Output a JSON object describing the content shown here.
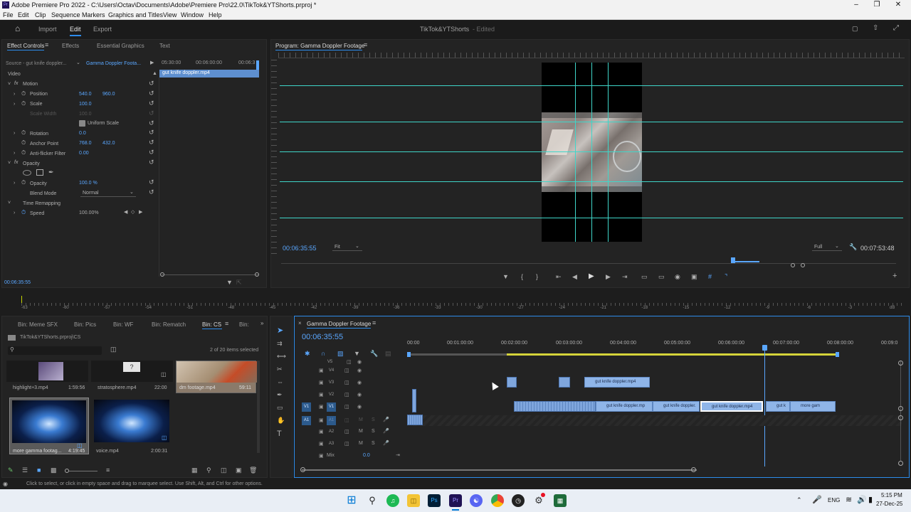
{
  "window": {
    "title": "Adobe Premiere Pro 2022 - C:\\Users\\Octav\\Documents\\Adobe\\Premiere Pro\\22.0\\TikTok&YTShorts.prproj *",
    "logo": "Pr"
  },
  "menu": [
    "File",
    "Edit",
    "Clip",
    "Sequence",
    "Markers",
    "Graphics and Titles",
    "View",
    "Window",
    "Help"
  ],
  "workspace": {
    "tabs": [
      "Import",
      "Edit",
      "Export"
    ],
    "active": "Edit",
    "project_name": "TikTok&YTShorts",
    "status": "- Edited"
  },
  "effect_controls": {
    "tabs": [
      "Effect Controls",
      "Effects",
      "Essential Graphics",
      "Text"
    ],
    "source": "Source - gut knife doppler...",
    "sequence": "Gamma Doppler Foota...",
    "ruler": [
      "05:30:00",
      "00:06:00:00",
      "00:06:3"
    ],
    "clip_name": "gut knife doppler.mp4",
    "section_video": "Video",
    "motion": "Motion",
    "position_label": "Position",
    "position_x": "540.0",
    "position_y": "960.0",
    "scale_label": "Scale",
    "scale": "100.0",
    "scale_width_label": "Scale Width",
    "scale_width": "100.0",
    "uniform_scale": "Uniform Scale",
    "rotation_label": "Rotation",
    "rotation": "0.0",
    "anchor_label": "Anchor Point",
    "anchor_x": "768.0",
    "anchor_y": "432.0",
    "antiflicker_label": "Anti-flicker Filter",
    "antiflicker": "0.00",
    "opacity_section": "Opacity",
    "opacity_label": "Opacity",
    "opacity": "100.0 %",
    "blend_label": "Blend Mode",
    "blend": "Normal",
    "time_remap": "Time Remapping",
    "speed_label": "Speed",
    "speed": "100.00%",
    "timecode": "00:06:35:55"
  },
  "program": {
    "title": "Program: Gamma Doppler Footage",
    "timecode": "00:06:35:55",
    "fit": "Fit",
    "quality": "Full",
    "duration": "00:07:53:48"
  },
  "audio_meter": [
    "-63",
    "-60",
    "-57",
    "-54",
    "-51",
    "-48",
    "-45",
    "-42",
    "-39",
    "-36",
    "-33",
    "-30",
    "-27",
    "-24",
    "-21",
    "-18",
    "-15",
    "-12",
    "-9",
    "-6",
    "-3",
    "dB"
  ],
  "project": {
    "tabs": [
      "Bin: Meme SFX",
      "Bin: Pics",
      "Bin: WF",
      "Bin: Rematch",
      "Bin: CS",
      "Bin:"
    ],
    "active": "Bin: CS",
    "path": "TikTok&YTShorts.prproj\\CS",
    "selection": "2 of 20 items selected",
    "items": [
      {
        "name": "highlight+3.mp4",
        "duration": "1:59:56"
      },
      {
        "name": "stratosphere.mp4",
        "duration": "22:00"
      },
      {
        "name": "dm footage.mp4",
        "duration": "59:11"
      },
      {
        "name": "more gamma footag...",
        "duration": "4:19:45"
      },
      {
        "name": "voice.mp4",
        "duration": "2:00:31"
      }
    ]
  },
  "timeline": {
    "title": "Gamma Doppler Footage",
    "timecode": "00:06:35:55",
    "ruler": [
      "00:00",
      "00:01:00:00",
      "00:02:00:00",
      "00:03:00:00",
      "00:04:00:00",
      "00:05:00:00",
      "00:06:00:00",
      "00:07:00:00",
      "00:08:00:00",
      "00:09:0"
    ],
    "tracks": [
      "V5",
      "V4",
      "V3",
      "V2",
      "V1",
      "A1",
      "A2",
      "A3"
    ],
    "mix_label": "Mix",
    "mix_value": "0.0",
    "clips": [
      "gut knife doppler.mp4",
      "gut knife doppler.mp",
      "gut knife doppler.",
      "gut knife doppler.mp4",
      "gut k",
      "more gam"
    ]
  },
  "status_bar": "Click to select, or click in empty space and drag to marquee select. Use Shift, Alt, and Ctrl for other options.",
  "taskbar": {
    "lang": "ENG",
    "time": "5:15 PM",
    "date": "27-Dec-25"
  }
}
